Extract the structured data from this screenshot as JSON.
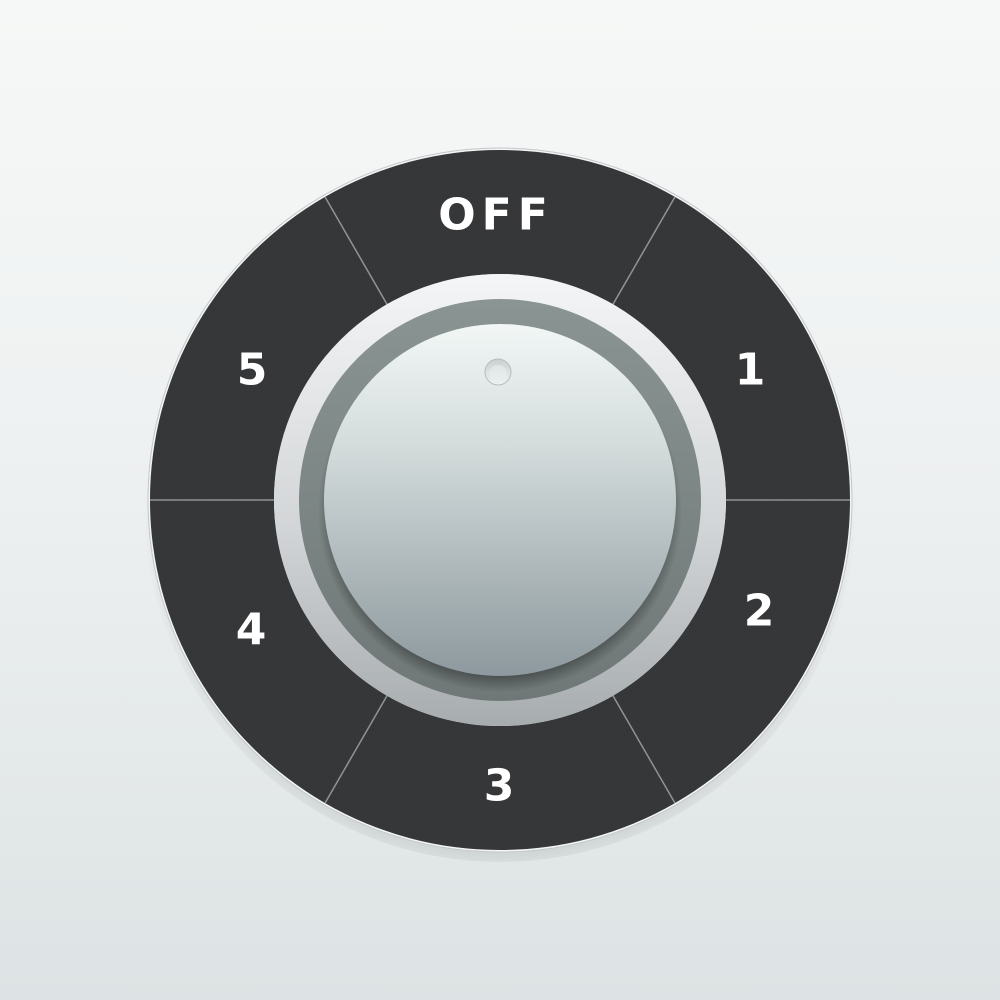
{
  "dial": {
    "labels": {
      "off": "OFF",
      "s1": "1",
      "s2": "2",
      "s3": "3",
      "s4": "4",
      "s5": "5"
    },
    "selected_position": "OFF",
    "colors": {
      "background_top": "#f6f8f7",
      "background_bottom": "#dde3e4",
      "ring": "#38393b",
      "divider": "#8f9496",
      "label": "#ffffff",
      "knob_top": "#eef3f2",
      "knob_bottom": "#8e9a9f",
      "bezel_outer": "#f1f2f3",
      "bezel_inner": "#7d8786"
    },
    "icons": {
      "indicator": "indicator-dot-icon"
    }
  }
}
